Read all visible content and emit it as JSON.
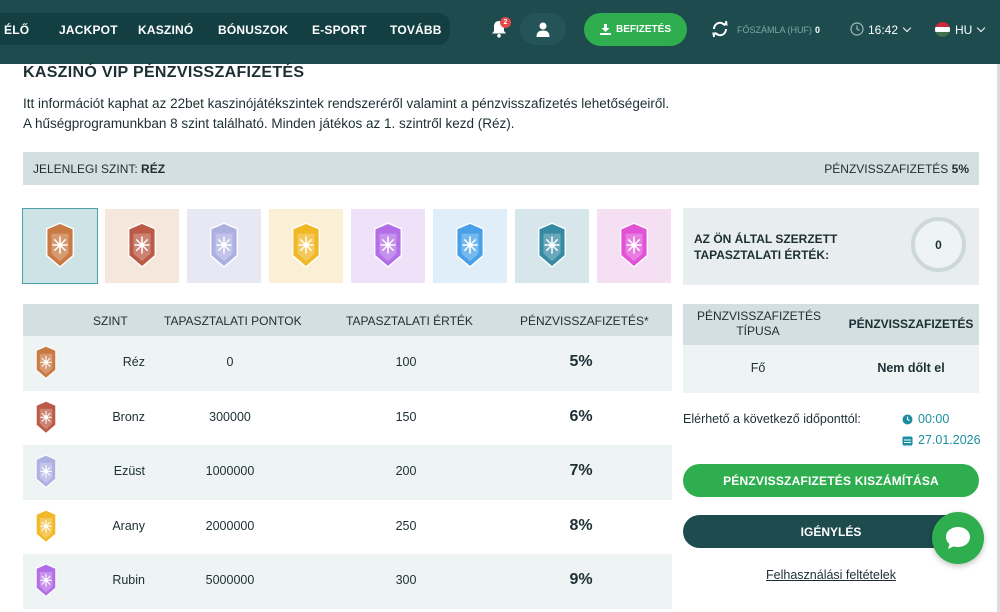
{
  "nav": {
    "items": [
      "ÉLŐ",
      "JACKPOT",
      "KASZINÓ",
      "BÓNUSZOK",
      "E-SPORT",
      "TOVÁBB"
    ],
    "notification_count": "2",
    "deposit_label": "BEFIZETÉS",
    "balance_label": "FŐSZÁMLA (HUF)",
    "balance_value": "0",
    "time": "16:42",
    "language": "HU"
  },
  "page": {
    "title": "KASZINÓ VIP PÉNZVISSZAFIZETÉS",
    "intro_line1": "Itt információt kaphat az 22bet kaszinójátékszintek rendszeréről valamint a pénzvisszafizetés lehetőségeiről.",
    "intro_line2": "A hűségprogramunkban 8 szint található. Minden játékos az 1. szintről kezd (Réz)."
  },
  "current_level": {
    "label": "JELENLEGI SZINT:",
    "value": "RÉZ",
    "cashback_label": "PÉNZVISSZAFIZETÉS",
    "cashback_value": "5%"
  },
  "badges": [
    {
      "name": "copper",
      "color": "#c8733a",
      "bg": "#cde3e6",
      "selected": true
    },
    {
      "name": "bronze",
      "color": "#b8533e",
      "bg": "#f6e7dd"
    },
    {
      "name": "silver",
      "color": "#a9aee0",
      "bg": "#e8e8f4"
    },
    {
      "name": "gold",
      "color": "#f1b51c",
      "bg": "#fbf0d6"
    },
    {
      "name": "ruby",
      "color": "#b067e6",
      "bg": "#efe2f8"
    },
    {
      "name": "sapphire",
      "color": "#3f9ce8",
      "bg": "#dfeef9"
    },
    {
      "name": "emerald",
      "color": "#2f86a0",
      "bg": "#d6e6ea"
    },
    {
      "name": "diamond",
      "color": "#e04bd6",
      "bg": "#f4dff3"
    }
  ],
  "xp": {
    "label_line1": "AZ ÖN ÁLTAL SZERZETT",
    "label_line2": "TAPASZTALATI ÉRTÉK:",
    "value": "0"
  },
  "table": {
    "headers": [
      "SZINT",
      "TAPASZTALATI PONTOK",
      "TAPASZTALATI ÉRTÉK",
      "PÉNZVISSZAFIZETÉS*"
    ],
    "rows": [
      {
        "level": "Réz",
        "points": "0",
        "value": "100",
        "cashback": "5%",
        "color": "#c8733a"
      },
      {
        "level": "Bronz",
        "points": "300000",
        "value": "150",
        "cashback": "6%",
        "color": "#b8533e"
      },
      {
        "level": "Ezüst",
        "points": "1000000",
        "value": "200",
        "cashback": "7%",
        "color": "#a9aee0"
      },
      {
        "level": "Arany",
        "points": "2000000",
        "value": "250",
        "cashback": "8%",
        "color": "#f1b51c"
      },
      {
        "level": "Rubin",
        "points": "5000000",
        "value": "300",
        "cashback": "9%",
        "color": "#b067e6"
      }
    ]
  },
  "cashback_panel": {
    "type_header_line1": "PÉNZVISSZAFIZETÉS",
    "type_header_line2": "TÍPUSA",
    "col2_header": "PÉNZVISSZAFIZETÉS",
    "type_value": "Fő",
    "status_value": "Nem dőlt el",
    "available_label": "Elérhető a következő időponttól:",
    "available_time": "00:00",
    "available_date": "27.01.2026",
    "calc_button": "PÉNZVISSZAFIZETÉS KISZÁMÍTÁSA",
    "claim_button": "IGÉNYLÉS",
    "terms_link": "Felhasználási feltételek"
  },
  "colors": {
    "header_bg": "#1d4b4e",
    "accent_green": "#2fae4f",
    "accent_teal": "#1b8ea0",
    "panel_gray": "#d3dfe1"
  }
}
